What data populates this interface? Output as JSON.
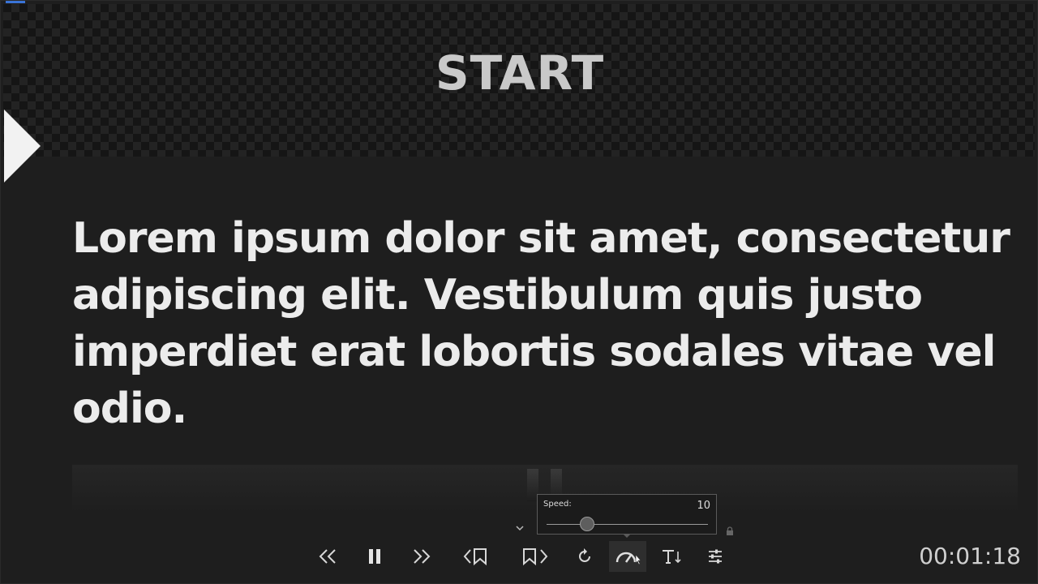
{
  "prompter": {
    "start_label": "START",
    "script_text": "Lorem ipsum dolor sit amet, consectetur adipiscing elit. Vestibulum quis justo imperdiet erat lobortis sodales vitae vel odio."
  },
  "speed_popup": {
    "label": "Speed:",
    "value": "10",
    "slider_fraction": 0.25
  },
  "controls": [
    {
      "name": "rewind-button",
      "icon": "double-chevron-left-icon"
    },
    {
      "name": "pause-button",
      "icon": "pause-icon"
    },
    {
      "name": "fast-forward-button",
      "icon": "double-chevron-right-icon"
    },
    {
      "name": "previous-marker-button",
      "icon": "bookmark-back-icon"
    },
    {
      "name": "next-marker-button",
      "icon": "bookmark-forward-icon"
    },
    {
      "name": "reset-button",
      "icon": "refresh-icon"
    },
    {
      "name": "speed-button",
      "icon": "speedometer-icon",
      "active": true
    },
    {
      "name": "text-size-button",
      "icon": "text-size-icon"
    },
    {
      "name": "settings-button",
      "icon": "sliders-icon"
    }
  ],
  "timer": "00:01:18",
  "colors": {
    "background": "#1e1e1e",
    "text": "#ececec",
    "accent": "#3a74d8"
  }
}
